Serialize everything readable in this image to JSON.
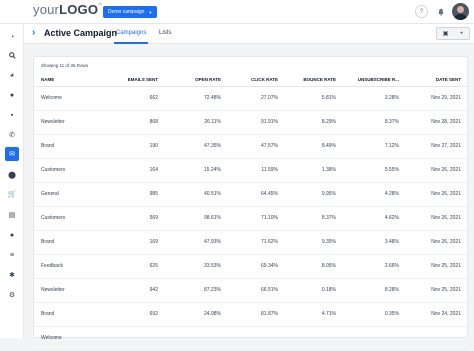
{
  "topbar": {
    "logo_light": "your",
    "logo_bold": "LOGO",
    "logo_tm": "™",
    "campaign_button": "Demo campaign",
    "help_icon": "question-icon",
    "bell_icon": "bell-icon"
  },
  "sidebar": {
    "icons": [
      "speedometer-icon",
      "search-icon",
      "pie-chart-icon",
      "chat-icon",
      "comment-icon",
      "phone-icon",
      "email-icon",
      "location-pin-icon",
      "cart-icon",
      "document-icon",
      "user-icon",
      "list-icon",
      "bug-icon",
      "gear-icon"
    ],
    "active_index": 6
  },
  "header": {
    "title": "Active Campaign",
    "tabs": [
      "Campaigns",
      "Lists"
    ],
    "active_tab": "Campaigns"
  },
  "table": {
    "showing": "Showing 11 of 35 Rows",
    "columns": [
      "NAME",
      "EMAILS SENT",
      "OPEN RATE",
      "CLICK RATE",
      "BOUNCE RATE",
      "UNSUBSCRIBE R...",
      "DATE SENT"
    ],
    "rows": [
      [
        "Welcome",
        "662",
        "72.48%",
        "27.07%",
        "5.81%",
        "3.28%",
        "Nov 29, 2021"
      ],
      [
        "Newsletter",
        "868",
        "26.11%",
        "91.91%",
        "8.29%",
        "8.37%",
        "Nov 28, 2021"
      ],
      [
        "Brand",
        "190",
        "47.35%",
        "47.57%",
        "8.49%",
        "7.12%",
        "Nov 27, 2021"
      ],
      [
        "Customers",
        "164",
        "15.24%",
        "11.59%",
        "1.38%",
        "5.55%",
        "Nov 26, 2021"
      ],
      [
        "General",
        "985",
        "40.51%",
        "64.45%",
        "9.95%",
        "4.28%",
        "Nov 26, 2021"
      ],
      [
        "Customers",
        "569",
        "98.61%",
        "71.10%",
        "8.37%",
        "4.62%",
        "Nov 26, 2021"
      ],
      [
        "Brand",
        "169",
        "47.93%",
        "71.62%",
        "9.35%",
        "3.48%",
        "Nov 26, 2021"
      ],
      [
        "Feedback",
        "625",
        "33.53%",
        "69.34%",
        "8.05%",
        "2.66%",
        "Nov 25, 2021"
      ],
      [
        "Newsletter",
        "942",
        "87.23%",
        "66.51%",
        "0.18%",
        "8.28%",
        "Nov 25, 2021"
      ],
      [
        "Brand",
        "692",
        "24.98%",
        "81.87%",
        "4.71%",
        "0.35%",
        "Nov 24, 2021"
      ],
      [
        "Welcome",
        "",
        "",
        "",
        "",
        "",
        ""
      ]
    ]
  }
}
